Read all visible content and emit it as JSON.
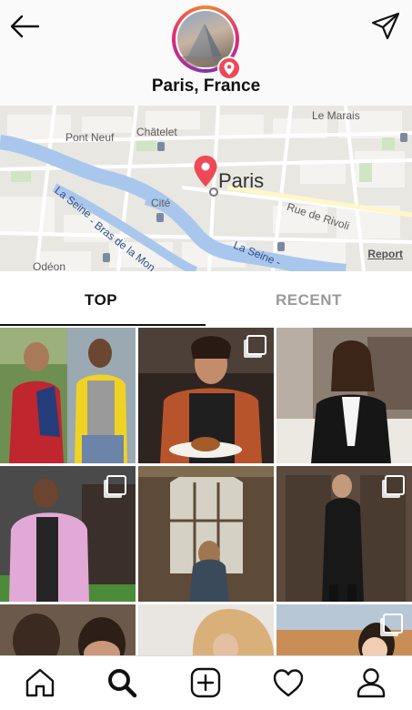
{
  "header": {
    "location_title": "Paris, France",
    "back_icon": "arrow-left-icon",
    "share_icon": "paper-plane-icon",
    "badge_icon": "location-pin-icon"
  },
  "map": {
    "labels": {
      "le_marais": "Le Marais",
      "pont_neuf": "Pont Neuf",
      "chatelet": "Châtelet",
      "cite": "Cité",
      "la_seine": "La Seine",
      "bras_de_la_monnaie": "- Bras de la Mon",
      "la_seine_2": "La Seine -",
      "rue_de_rivoli": "Rue de Rivoli",
      "odeon": "Odéon",
      "paris": "Paris"
    },
    "report_link": "Report",
    "pin_color": "#ed4956",
    "river_color": "#a9c7ec"
  },
  "tabs": {
    "top": "TOP",
    "recent": "RECENT",
    "active": "TOP"
  },
  "grid": {
    "posts": [
      {
        "subject": "two teens outdoors, red jacket and yellow jacket",
        "multi": false
      },
      {
        "subject": "woman plating food, chef apron",
        "multi": true
      },
      {
        "subject": "woman in black blazer, white shirt",
        "multi": false
      },
      {
        "subject": "man in pink puffer jacket at fashion show",
        "multi": true
      },
      {
        "subject": "woman in gallery with arched windows",
        "multi": false
      },
      {
        "subject": "man in black coat before wooden doors",
        "multi": true
      },
      {
        "subject": "two men portrait",
        "multi": false
      },
      {
        "subject": "woman with blonde hair",
        "multi": false
      },
      {
        "subject": "woman smiling, city rooftops",
        "multi": true
      }
    ]
  },
  "navbar": {
    "items": [
      {
        "icon": "home-icon",
        "active": false
      },
      {
        "icon": "search-icon",
        "active": true
      },
      {
        "icon": "add-post-icon",
        "active": false
      },
      {
        "icon": "heart-icon",
        "active": false
      },
      {
        "icon": "profile-icon",
        "active": false
      }
    ]
  },
  "colors": {
    "accent_red": "#ed4956",
    "text_primary": "#111111",
    "text_muted": "#9a9a9a"
  }
}
